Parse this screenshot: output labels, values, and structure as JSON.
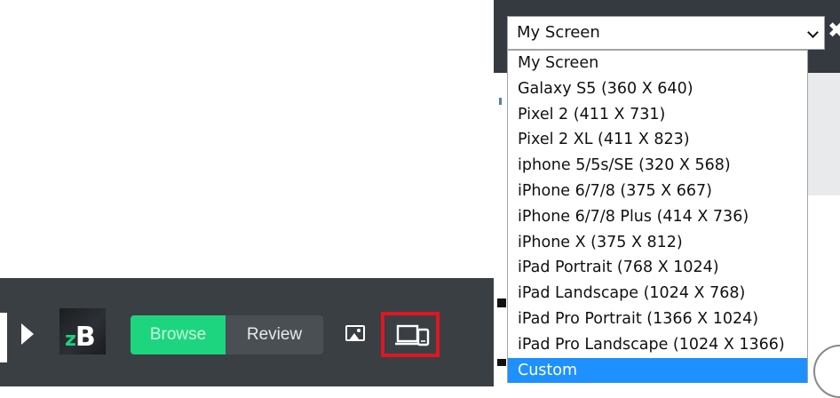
{
  "toolbar": {
    "logo_z": "z",
    "logo_b": "B",
    "browse_label": "Browse",
    "review_label": "Review",
    "icons": [
      "play-icon",
      "image-icon",
      "responsive-device-icon"
    ],
    "highlight_color": "#e01621",
    "accent_color": "#1ed57f"
  },
  "device_select": {
    "value": "My Screen",
    "options": [
      "My Screen",
      "Galaxy S5 (360 X 640)",
      "Pixel 2 (411 X 731)",
      "Pixel 2 XL (411 X 823)",
      "iphone 5/5s/SE (320 X 568)",
      "iPhone 6/7/8 (375 X 667)",
      "iPhone 6/7/8 Plus (414 X 736)",
      "iPhone X (375 X 812)",
      "iPad Portrait (768 X 1024)",
      "iPad Landscape (1024 X 768)",
      "iPad Pro Portrait (1366 X 1024)",
      "iPad Pro Landscape (1024 X 1366)",
      "Custom"
    ],
    "highlighted_option": "Custom",
    "highlight_color": "#1e90ff",
    "close_icon": "close-icon"
  }
}
